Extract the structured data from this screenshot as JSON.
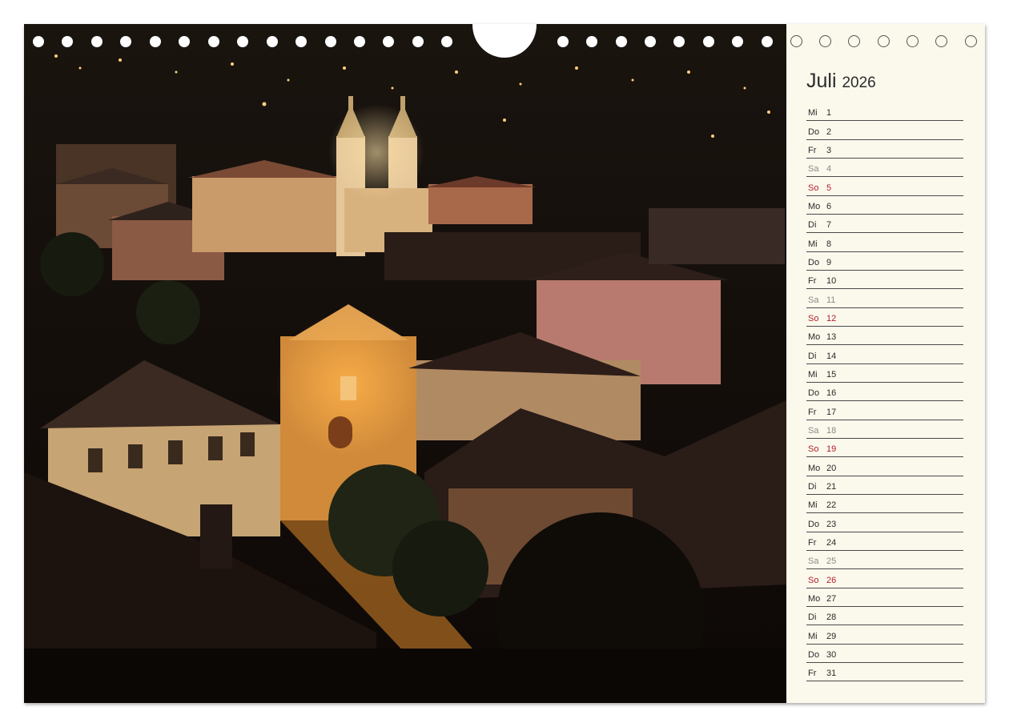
{
  "calendar": {
    "month": "Juli",
    "year": "2026",
    "days": [
      {
        "wd": "Mi",
        "num": "1",
        "kind": "weekday"
      },
      {
        "wd": "Do",
        "num": "2",
        "kind": "weekday"
      },
      {
        "wd": "Fr",
        "num": "3",
        "kind": "weekday"
      },
      {
        "wd": "Sa",
        "num": "4",
        "kind": "sat"
      },
      {
        "wd": "So",
        "num": "5",
        "kind": "sun"
      },
      {
        "wd": "Mo",
        "num": "6",
        "kind": "weekday"
      },
      {
        "wd": "Di",
        "num": "7",
        "kind": "weekday"
      },
      {
        "wd": "Mi",
        "num": "8",
        "kind": "weekday"
      },
      {
        "wd": "Do",
        "num": "9",
        "kind": "weekday"
      },
      {
        "wd": "Fr",
        "num": "10",
        "kind": "weekday"
      },
      {
        "wd": "Sa",
        "num": "11",
        "kind": "sat"
      },
      {
        "wd": "So",
        "num": "12",
        "kind": "sun"
      },
      {
        "wd": "Mo",
        "num": "13",
        "kind": "weekday"
      },
      {
        "wd": "Di",
        "num": "14",
        "kind": "weekday"
      },
      {
        "wd": "Mi",
        "num": "15",
        "kind": "weekday"
      },
      {
        "wd": "Do",
        "num": "16",
        "kind": "weekday"
      },
      {
        "wd": "Fr",
        "num": "17",
        "kind": "weekday"
      },
      {
        "wd": "Sa",
        "num": "18",
        "kind": "sat"
      },
      {
        "wd": "So",
        "num": "19",
        "kind": "sun"
      },
      {
        "wd": "Mo",
        "num": "20",
        "kind": "weekday"
      },
      {
        "wd": "Di",
        "num": "21",
        "kind": "weekday"
      },
      {
        "wd": "Mi",
        "num": "22",
        "kind": "weekday"
      },
      {
        "wd": "Do",
        "num": "23",
        "kind": "weekday"
      },
      {
        "wd": "Fr",
        "num": "24",
        "kind": "weekday"
      },
      {
        "wd": "Sa",
        "num": "25",
        "kind": "sat"
      },
      {
        "wd": "So",
        "num": "26",
        "kind": "sun"
      },
      {
        "wd": "Mo",
        "num": "27",
        "kind": "weekday"
      },
      {
        "wd": "Di",
        "num": "28",
        "kind": "weekday"
      },
      {
        "wd": "Mi",
        "num": "29",
        "kind": "weekday"
      },
      {
        "wd": "Do",
        "num": "30",
        "kind": "weekday"
      },
      {
        "wd": "Fr",
        "num": "31",
        "kind": "weekday"
      }
    ]
  },
  "colors": {
    "paper": "#fbf9ec",
    "sunday": "#b21f2d",
    "saturday": "#8a8a8a",
    "text": "#2b2b2b"
  }
}
